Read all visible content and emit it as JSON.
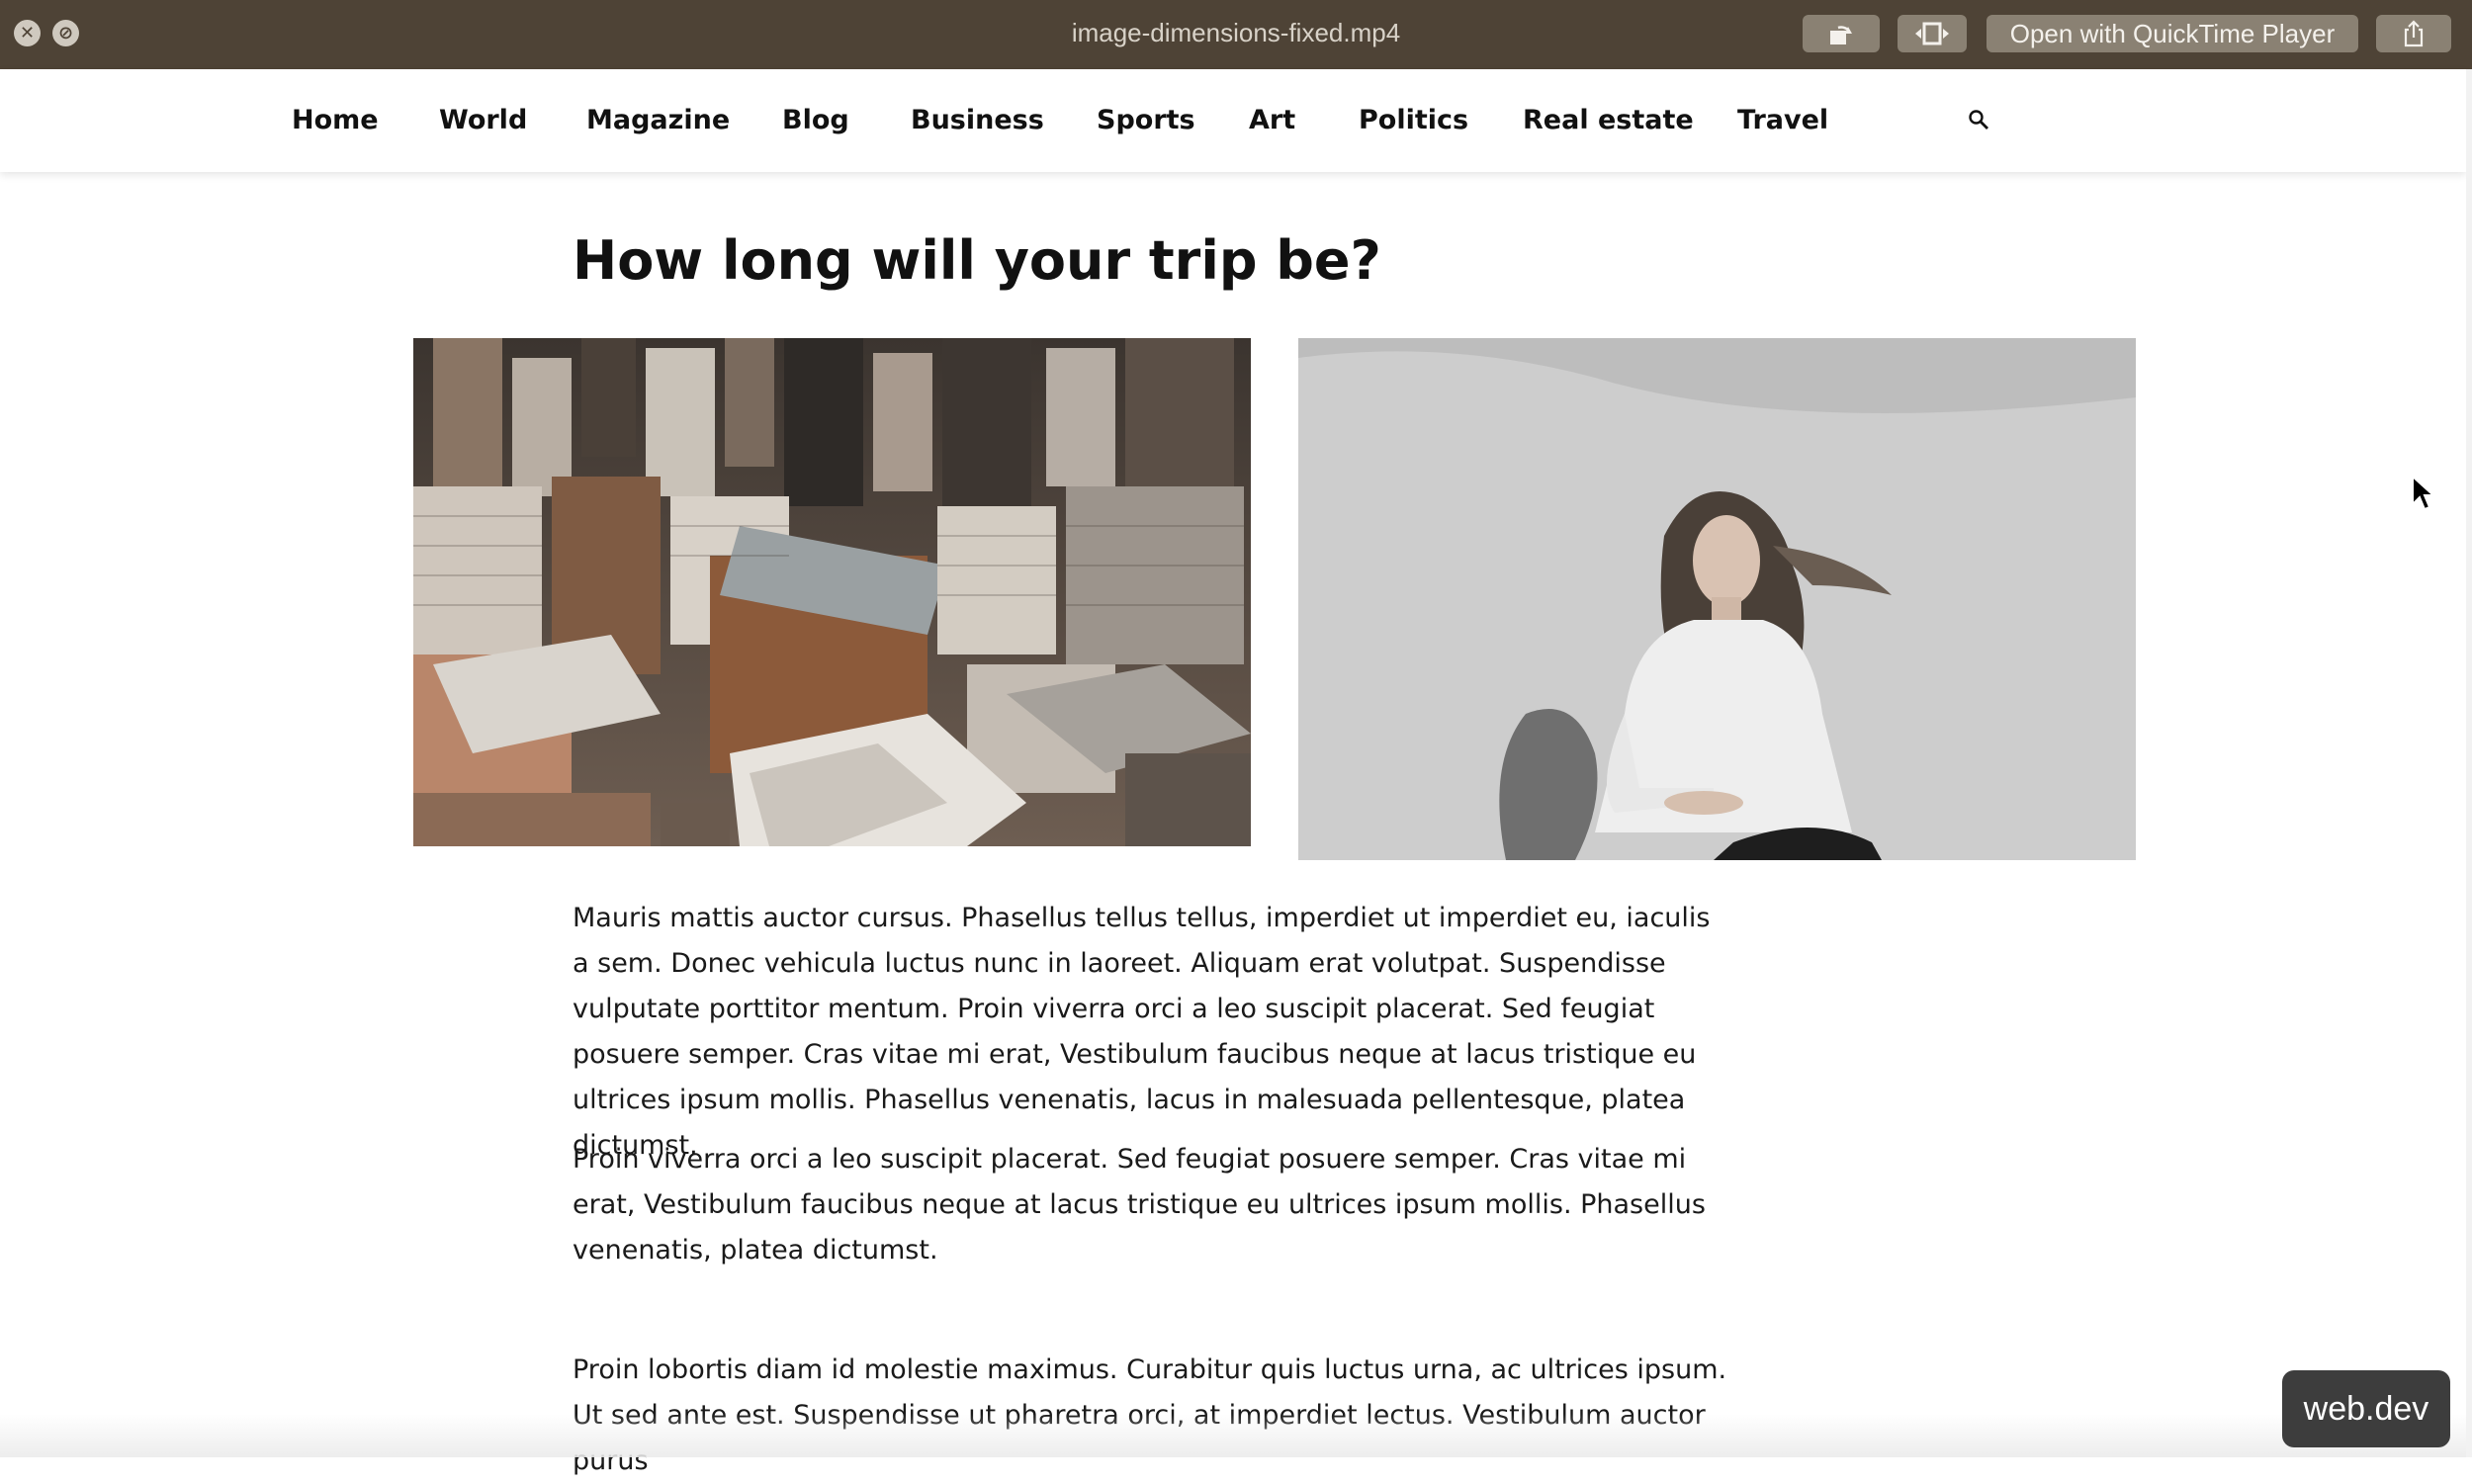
{
  "window": {
    "title": "image-dimensions-fixed.mp4",
    "close_glyph": "✕",
    "fullscreen_glyph": "⊘",
    "open_with_label": "Open with QuickTime Player"
  },
  "nav": {
    "items": [
      "Home",
      "World",
      "Magazine",
      "Blog",
      "Business",
      "Sports",
      "Art",
      "Politics",
      "Real estate",
      "Travel"
    ],
    "search_icon": "search-icon"
  },
  "article": {
    "heading": "How long will your trip be?",
    "images": [
      {
        "name": "city-aerial-photo"
      },
      {
        "name": "woman-in-sand-photo"
      }
    ],
    "paragraphs": [
      "Mauris mattis auctor cursus. Phasellus tellus tellus, imperdiet ut imperdiet eu, iaculis a sem. Donec vehicula luctus nunc in laoreet. Aliquam erat volutpat. Suspendisse vulputate porttitor mentum. Proin viverra orci a leo suscipit placerat. Sed feugiat posuere semper. Cras vitae mi erat, Vestibulum faucibus neque at lacus tristique eu ultrices ipsum mollis. Phasellus venenatis, lacus in malesuada pellentesque, platea dictumst.",
      "Proin viverra orci a leo suscipit placerat. Sed feugiat posuere semper. Cras vitae mi erat, Vestibulum faucibus neque at lacus tristique eu ultrices ipsum mollis. Phasellus venenatis, platea dictumst.",
      "Proin lobortis diam id molestie maximus. Curabitur quis luctus urna, ac ultrices ipsum. Ut sed ante est. Suspendisse ut pharetra orci, at imperdiet lectus. Vestibulum auctor purus"
    ]
  },
  "badge": {
    "label": "web.dev"
  }
}
